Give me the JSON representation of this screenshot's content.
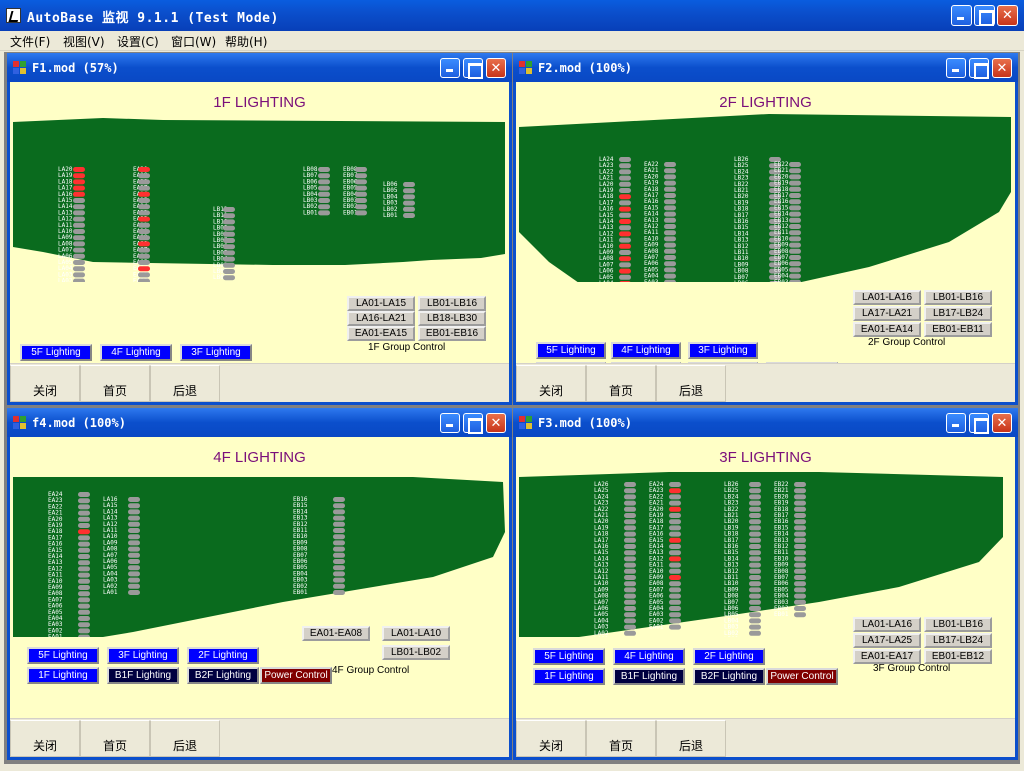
{
  "app": {
    "title": "AutoBase 监视 9.1.1 (Test Mode)",
    "menu": [
      "文件(F)",
      "视图(V)",
      "设置(C)",
      "窗口(W)",
      "帮助(H)"
    ]
  },
  "footer_labels": [
    "关闭",
    "首页",
    "后退"
  ],
  "nav_labels": {
    "f5": "5F Lighting",
    "f4": "4F Lighting",
    "f3": "3F Lighting",
    "f2": "2F Lighting",
    "f1": "1F Lighting",
    "b1": "B1F Lighting",
    "b2": "B2F Lighting",
    "power": "Power Control"
  },
  "windows": [
    {
      "id": "f1",
      "title": "F1.mod (57%)",
      "heading": "1F LIGHTING",
      "group_caption": "1F Group Control",
      "group_buttons": [
        "LA01-LA15",
        "LB01-LB16",
        "LA16-LA21",
        "LB18-LB30",
        "EA01-EA15",
        "EB01-EB16"
      ]
    },
    {
      "id": "f2",
      "title": "F2.mod (100%)",
      "heading": "2F LIGHTING",
      "group_caption": "2F Group Control",
      "group_buttons": [
        "LA01-LA16",
        "LB01-LB16",
        "LA17-LA21",
        "LB17-LB24",
        "EA01-EA14",
        "EB01-EB11"
      ]
    },
    {
      "id": "f4",
      "title": "f4.mod (100%)",
      "heading": "4F LIGHTING",
      "group_caption": "4F Group Control",
      "group_buttons": [
        "EA01-EA08",
        "LA01-LA10",
        "LB01-LB02"
      ]
    },
    {
      "id": "f3",
      "title": "F3.mod (100%)",
      "heading": "3F LIGHTING",
      "group_caption": "3F Group Control",
      "group_buttons": [
        "LA01-LA16",
        "LB01-LB16",
        "LA17-LA25",
        "LB17-LB24",
        "EA01-EA17",
        "EB01-EB12"
      ]
    }
  ],
  "colors": {
    "floorplan": "#0a6b1e",
    "lamp_on": "#ff3030",
    "lamp_off": "#9a9a9a",
    "panel_bg": "#ffffc6",
    "heading": "#7a0f7a"
  },
  "icons": {
    "app": "autobase-app-icon",
    "child": "mdi-window-icon"
  }
}
